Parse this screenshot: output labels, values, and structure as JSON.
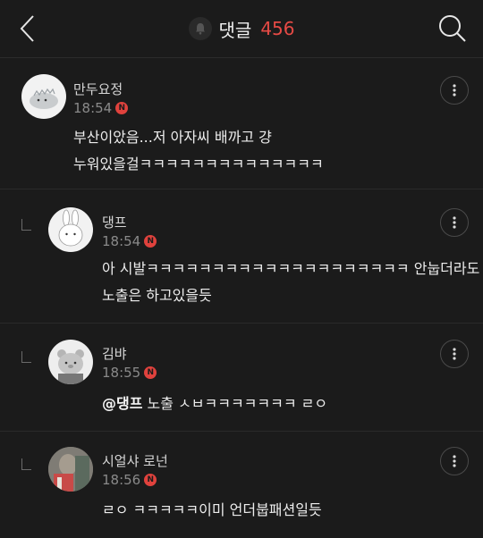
{
  "header": {
    "title": "댓글",
    "count": "456"
  },
  "colors": {
    "accent": "#e64a45",
    "background": "#1b1b1b"
  },
  "comments": [
    {
      "author": "만두요정",
      "time": "18:54",
      "badge": "N",
      "lines": [
        "부산이았음...저 아자씨 배까고 걍",
        "누워있을걸ㅋㅋㅋㅋㅋㅋㅋㅋㅋㅋㅋㅋㅋㅋ"
      ],
      "is_reply": false
    },
    {
      "author": "댕프",
      "time": "18:54",
      "badge": "N",
      "lines": [
        "아 시발ㅋㅋㅋㅋㅋㅋㅋㅋㅋㅋㅋㅋㅋㅋㅋㅋㅋㅋㅋㅋ 안눕더라도",
        "노출은 하고있을듯"
      ],
      "is_reply": true
    },
    {
      "author": "김뱌",
      "time": "18:55",
      "badge": "N",
      "mention": "@댕프",
      "text": " 노출 ㅅㅂㅋㅋㅋㅋㅋㅋㅋ ㄹㅇ",
      "is_reply": true
    },
    {
      "author": "시얼샤 로넌",
      "time": "18:56",
      "badge": "N",
      "text": "ㄹㅇ ㅋㅋㅋㅋㅋ이미 언더붑패션일듯",
      "is_reply": true
    }
  ],
  "icons": {
    "back": "chevron-left-icon",
    "bell": "bell-icon",
    "search": "search-icon",
    "more": "more-vertical-icon",
    "reply": "reply-indent-icon"
  }
}
